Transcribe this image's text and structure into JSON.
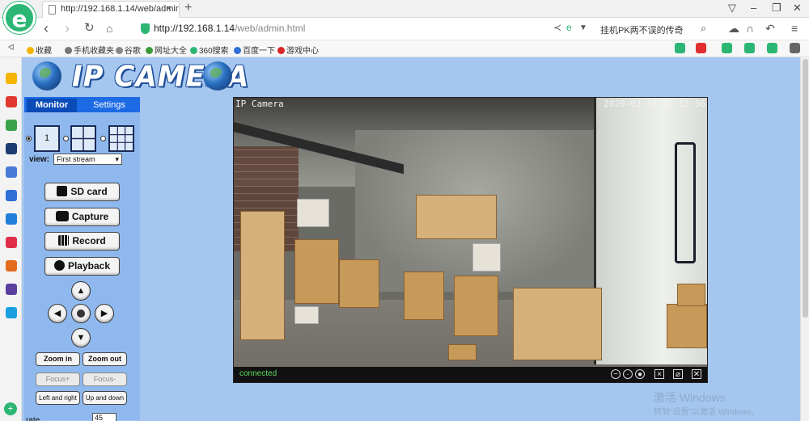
{
  "browser": {
    "logo_letter": "e",
    "tab_title": "http://192.168.1.14/web/admin",
    "tab_close": "×",
    "new_tab": "+",
    "url_host": "http://192.168.1.14",
    "url_path": "/web/admin.html",
    "search_text": "挂机PK两不误的传奇",
    "favorites": [
      "收藏",
      "手机收藏夹",
      "谷歌",
      "网址大全",
      "360搜索",
      "百度一下",
      "游戏中心"
    ],
    "window_controls": [
      "▽",
      "–",
      "❐",
      "✕"
    ]
  },
  "page": {
    "brand_title": "IP CAMERA",
    "tabs": {
      "monitor": "Monitor",
      "settings": "Settings"
    },
    "layout_single": "1",
    "view_label": "view:",
    "view_value": "First stream",
    "buttons": {
      "sd_card": "SD card",
      "capture": "Capture",
      "record": "Record",
      "playback": "Playback"
    },
    "ptz": {
      "up": "▲",
      "down": "▼",
      "left": "◀",
      "right": "▶"
    },
    "zoom_in": "Zoom in",
    "zoom_out": "Zoom out",
    "focus_plus": "Focus+",
    "focus_minus": "Focus-",
    "left_right": "Left and right",
    "up_down": "Up and down",
    "rate_label": "rate",
    "rate_value": "45"
  },
  "video": {
    "overlay_title": "IP Camera",
    "overlay_timestamp": "2020-03-18  11:12:56",
    "status": "connected"
  },
  "watermark": {
    "line1": "激活 Windows",
    "line2": "转到\"设置\"以激活 Windows。"
  },
  "colors": {
    "page_bg": "#a5c6ef",
    "panel_blue": "#1c6be4",
    "browser_green": "#2bb673"
  }
}
